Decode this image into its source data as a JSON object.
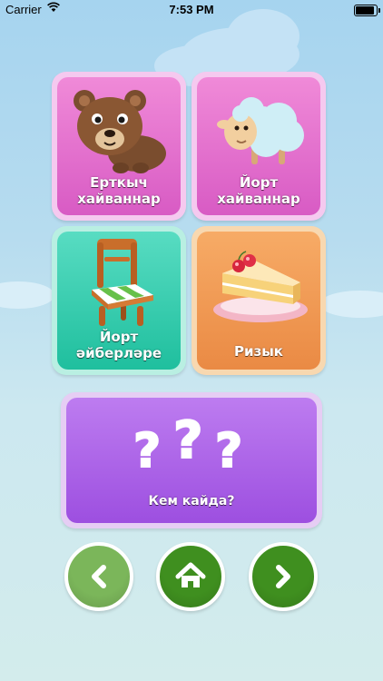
{
  "status_bar": {
    "carrier": "Carrier",
    "time": "7:53 PM",
    "battery_level": 1.0
  },
  "categories": [
    {
      "label_line1": "Ерткыч",
      "label_line2": "хайваннар",
      "icon": "bear-icon",
      "color": "#e46fcf"
    },
    {
      "label_line1": "Йорт",
      "label_line2": "хайваннар",
      "icon": "sheep-icon",
      "color": "#e46fcf"
    },
    {
      "label_line1": "Йорт",
      "label_line2": "әйберләре",
      "icon": "chair-icon",
      "color": "#33ccad"
    },
    {
      "label_line1": "Ризык",
      "label_line2": "",
      "icon": "cake-icon",
      "color": "#ef9a52"
    }
  ],
  "quiz": {
    "label": "Кем кайда?",
    "icon": "question-marks-icon",
    "color": "#ab60e8"
  },
  "nav": {
    "back_icon": "chevron-left-icon",
    "home_icon": "home-icon",
    "forward_icon": "chevron-right-icon",
    "back_color": "#7bb65a",
    "home_color": "#3f8f1f",
    "forward_color": "#3f8f1f"
  }
}
